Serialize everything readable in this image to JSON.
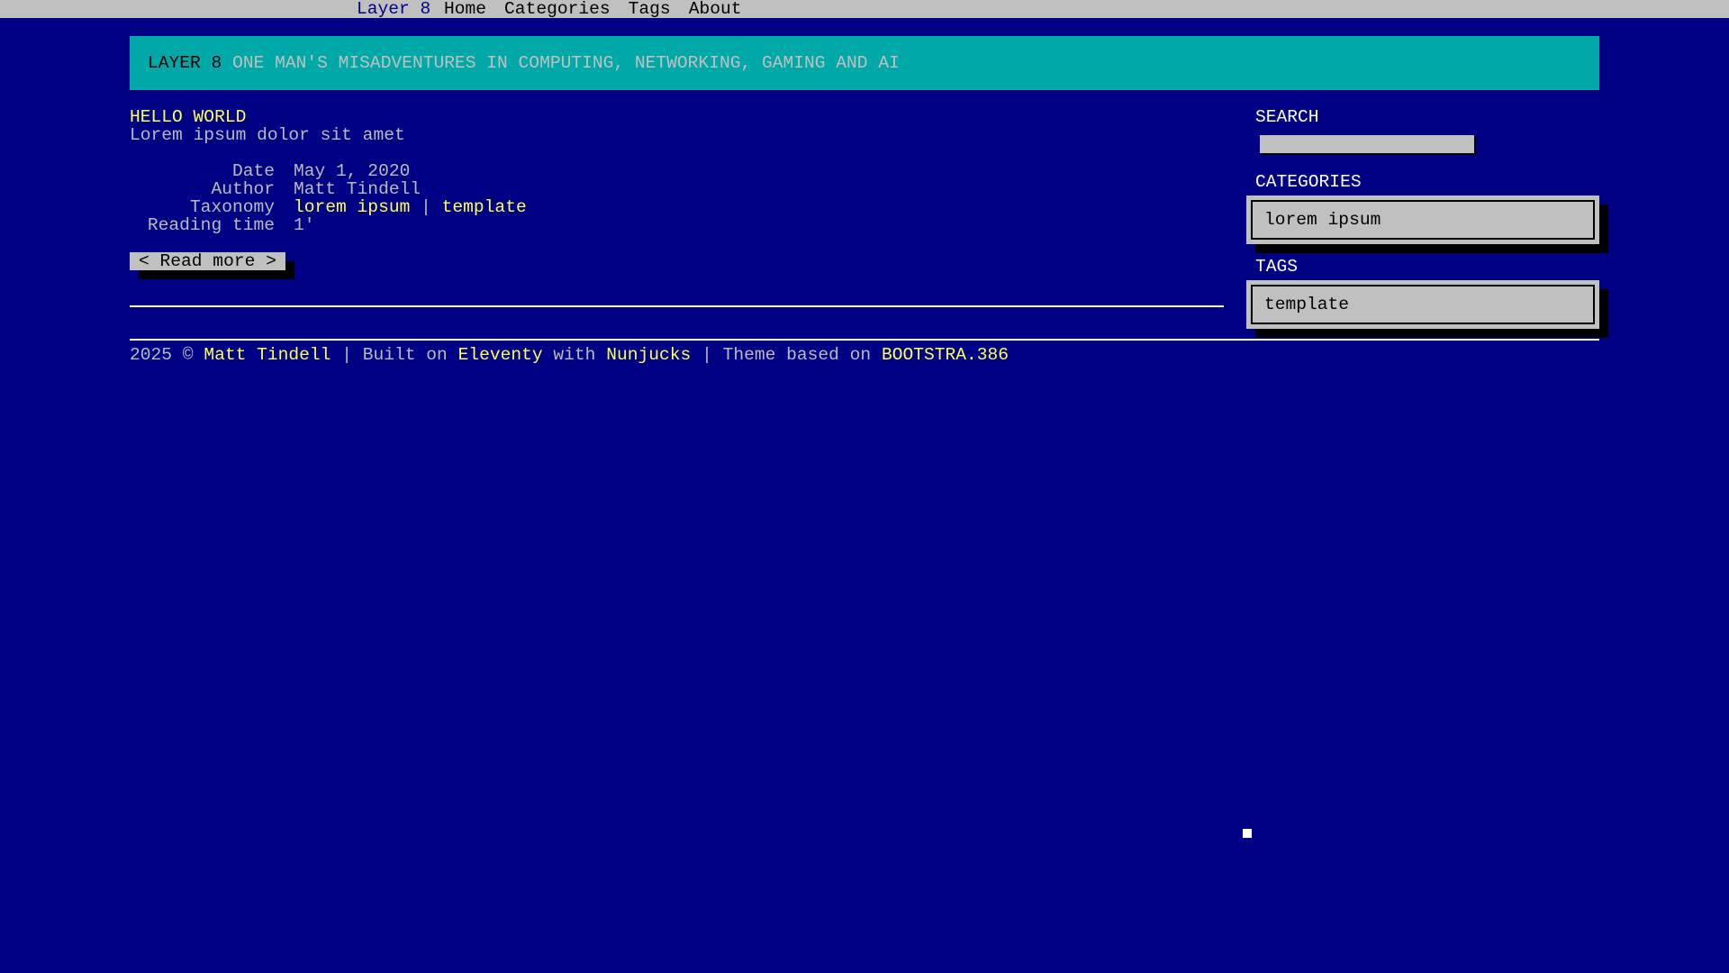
{
  "navbar": {
    "brand": "Layer 8",
    "items": [
      {
        "label": "Home"
      },
      {
        "label": "Categories"
      },
      {
        "label": "Tags"
      },
      {
        "label": "About"
      }
    ]
  },
  "jumbotron": {
    "site_name": "LAYER 8",
    "tagline": "ONE MAN'S MISADVENTURES IN COMPUTING, NETWORKING, GAMING AND AI"
  },
  "post": {
    "title": "HELLO WORLD",
    "summary": "Lorem ipsum dolor sit amet",
    "meta": {
      "date_label": "Date",
      "date_value": "May 1, 2020",
      "author_label": "Author",
      "author_value": "Matt Tindell",
      "taxonomy_label": "Taxonomy",
      "taxonomy_category": "lorem ipsum",
      "taxonomy_separator": "|",
      "taxonomy_tag": "template",
      "reading_time_label": "Reading time",
      "reading_time_value": "1'"
    },
    "read_more": "< Read more >"
  },
  "sidebar": {
    "search_heading": "SEARCH",
    "search_value": "",
    "categories_heading": "CATEGORIES",
    "categories": [
      "lorem ipsum"
    ],
    "tags_heading": "TAGS",
    "tags": [
      "template"
    ]
  },
  "footer": {
    "year": "2025 ©",
    "author_link": "Matt Tindell",
    "built_on": "| Built on",
    "eleventy_link": "Eleventy",
    "with": "with",
    "nunjucks_link": "Nunjucks",
    "theme_based": "| Theme based on",
    "theme_link": "BOOTSTRA.386"
  },
  "colors": {
    "background": "#000084",
    "navbar": "#c0c0c0",
    "jumbotron": "#00a8a8",
    "link": "#ffff54",
    "text": "#bbbbbb"
  }
}
